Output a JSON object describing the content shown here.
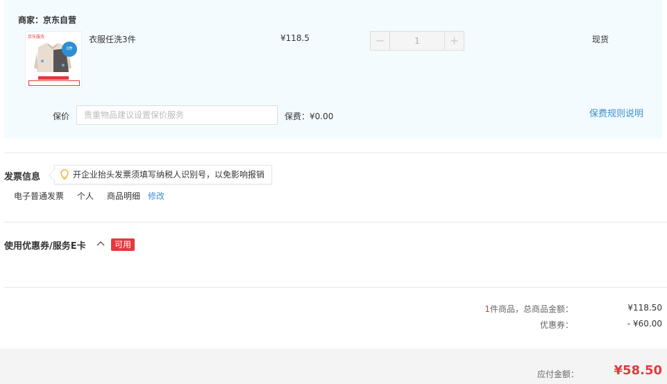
{
  "merchant": {
    "label": "商家：京东自营"
  },
  "item": {
    "thumb_brand": "京东服洗",
    "thumb_badge": "3件",
    "name": "衣服任洗3件",
    "price": "¥118.5",
    "qty_minus": "−",
    "quantity": "1",
    "qty_plus": "+",
    "stock": "现货"
  },
  "insurance": {
    "label": "保价",
    "placeholder": "贵重物品建议设置保价服务",
    "fee_label": "保费：",
    "fee_value": "¥0.00",
    "rules_link": "保费规则说明"
  },
  "invoice": {
    "title": "发票信息",
    "tip": "开企业抬头发票须填写纳税人识别号，以免影响报销",
    "type": "电子普通发票",
    "header": "个人",
    "content": "商品明细",
    "edit": "修改"
  },
  "coupon": {
    "title": "使用优惠券/服务E卡",
    "toggle_icon": "chevron-up-icon",
    "available_tag": "可用"
  },
  "summary": {
    "count": "1",
    "goods_label": "件商品，总商品金额：",
    "goods_total": "¥118.50",
    "coupon_label": "优惠券：",
    "coupon_value": "- ¥60.00",
    "pay_label": "应付金额：",
    "pay_amount": "¥58.50"
  },
  "colors": {
    "accent": "#e4393c",
    "link": "#3b8fd1",
    "order_bg": "#f3fbfe"
  }
}
